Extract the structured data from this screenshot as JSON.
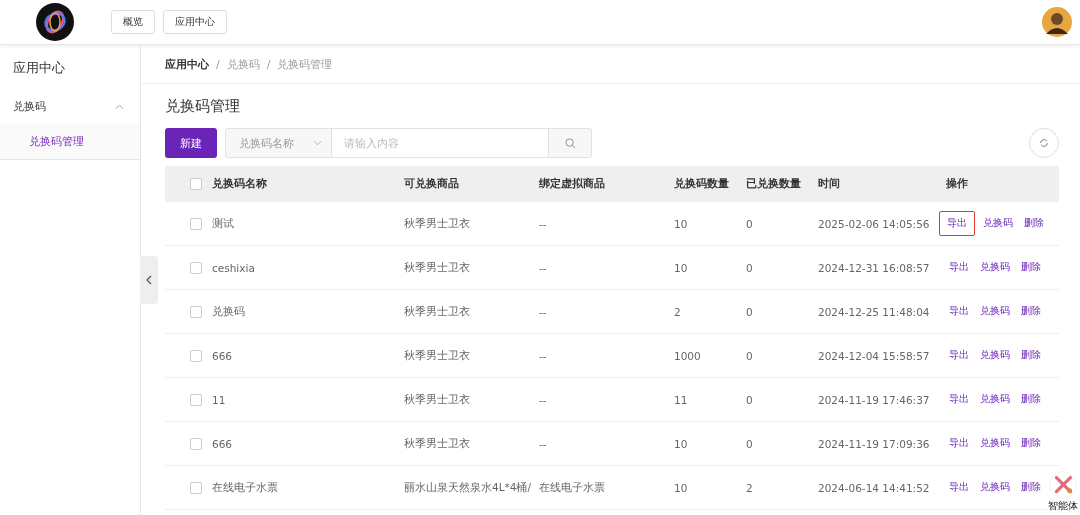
{
  "header": {
    "nav_buttons": [
      "概览",
      "应用中心"
    ]
  },
  "sidebar": {
    "title": "应用中心",
    "groups": [
      {
        "label": "兑换码",
        "expanded": true,
        "children": [
          {
            "label": "兑换码管理",
            "selected": true
          }
        ]
      }
    ]
  },
  "breadcrumb": {
    "separator": "/",
    "items": [
      "应用中心",
      "兑换码",
      "兑换码管理"
    ]
  },
  "page_title": "兑换码管理",
  "toolbar": {
    "new_button": "新建",
    "filter": "兑换码名称",
    "search": {
      "placeholder": "请输入内容"
    }
  },
  "table": {
    "all_checked": false,
    "columns": [
      "兑换码名称",
      "可兑换商品",
      "绑定虚拟商品",
      "兑换码数量",
      "已兑换数量",
      "时间",
      "操作"
    ],
    "rows": [
      {
        "cells": [
          "测试",
          "秋季男士卫衣",
          "--",
          "10",
          "0",
          "2025-02-06 14:05:56"
        ],
        "actions": [
          "导出",
          "兑换码",
          "删除"
        ],
        "highlighted": true,
        "checked": false
      },
      {
        "cells": [
          "ceshixia",
          "秋季男士卫衣",
          "--",
          "10",
          "0",
          "2024-12-31 16:08:57"
        ],
        "actions": [
          "导出",
          "兑换码",
          "删除"
        ],
        "highlighted": false,
        "checked": false
      },
      {
        "cells": [
          "兑换码",
          "秋季男士卫衣",
          "--",
          "2",
          "0",
          "2024-12-25 11:48:04"
        ],
        "actions": [
          "导出",
          "兑换码",
          "删除"
        ],
        "highlighted": false,
        "checked": false
      },
      {
        "cells": [
          "666",
          "秋季男士卫衣",
          "--",
          "1000",
          "0",
          "2024-12-04 15:58:57"
        ],
        "actions": [
          "导出",
          "兑换码",
          "删除"
        ],
        "highlighted": false,
        "checked": false
      },
      {
        "cells": [
          "11",
          "秋季男士卫衣",
          "--",
          "11",
          "0",
          "2024-11-19 17:46:37"
        ],
        "actions": [
          "导出",
          "兑换码",
          "删除"
        ],
        "highlighted": false,
        "checked": false
      },
      {
        "cells": [
          "666",
          "秋季男士卫衣",
          "--",
          "10",
          "0",
          "2024-11-19 17:09:36"
        ],
        "actions": [
          "导出",
          "兑换码",
          "删除"
        ],
        "highlighted": false,
        "checked": false
      },
      {
        "cells": [
          "在线电子水票",
          "丽水山泉天然泉水4L*4桶/",
          "在线电子水票",
          "10",
          "2",
          "2024-06-14 14:41:52"
        ],
        "actions": [
          "导出",
          "兑换码",
          "删除"
        ],
        "highlighted": false,
        "checked": false
      }
    ]
  },
  "assistant": {
    "label": "智能体"
  }
}
